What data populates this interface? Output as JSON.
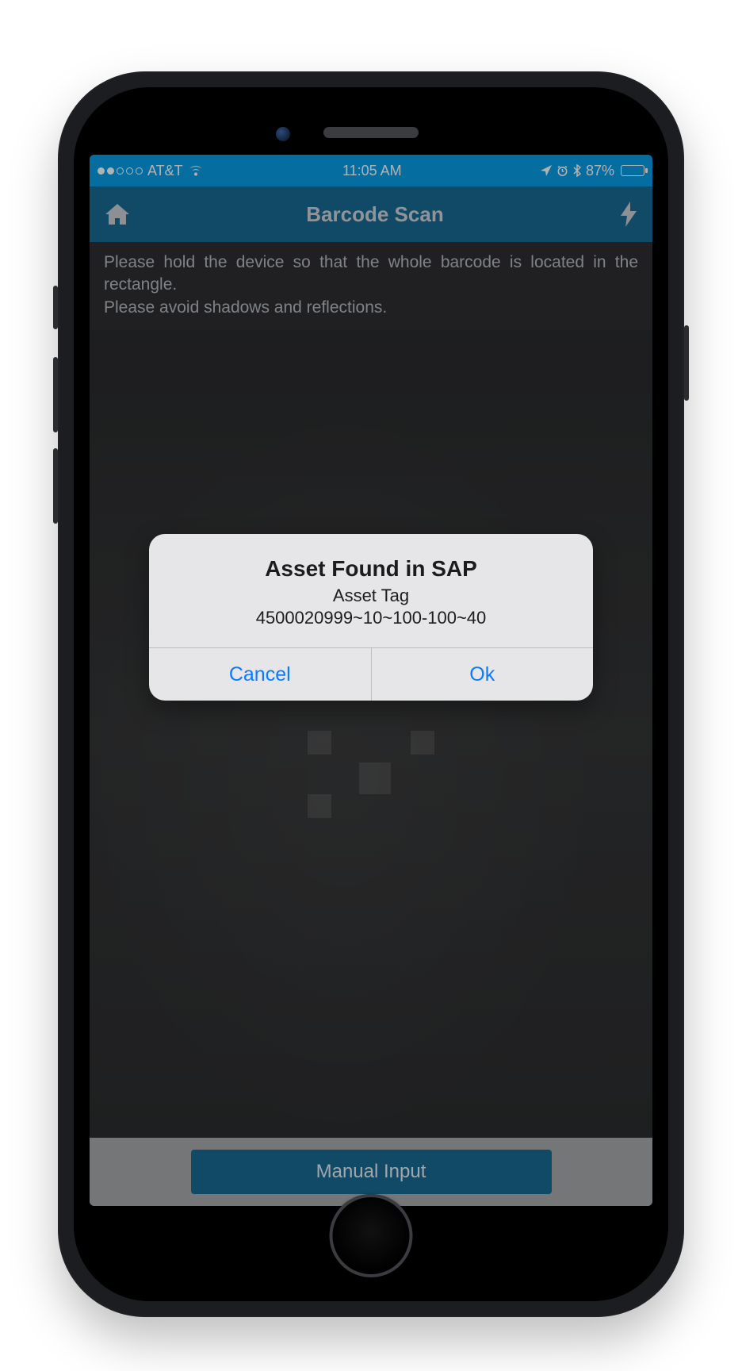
{
  "status": {
    "signal_filled": 2,
    "signal_total": 5,
    "carrier": "AT&T",
    "time": "11:05 AM",
    "battery_pct": "87%"
  },
  "nav": {
    "title": "Barcode Scan"
  },
  "instructions": {
    "line1": "Please hold the device so that the whole barcode is located in the rectangle.",
    "line2": "Please avoid shadows and reflections."
  },
  "footer": {
    "manual_input_label": "Manual Input"
  },
  "alert": {
    "title": "Asset Found in SAP",
    "subtitle_label": "Asset Tag",
    "asset_tag": "4500020999~10~100-100~40",
    "cancel": "Cancel",
    "ok": "Ok"
  }
}
